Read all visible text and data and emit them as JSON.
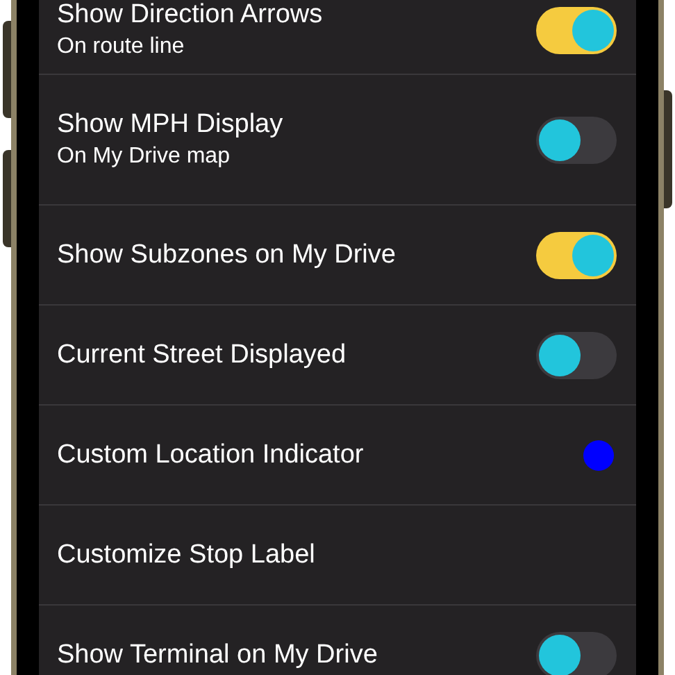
{
  "settings": [
    {
      "kind": "toggle",
      "title": "Show Direction Arrows",
      "subtitle": "On route line",
      "on": true
    },
    {
      "kind": "toggle",
      "title": "Show MPH Display",
      "subtitle": "On My Drive map",
      "on": false
    },
    {
      "kind": "toggle",
      "title": "Show Subzones on My Drive",
      "on": true
    },
    {
      "kind": "toggle",
      "title": "Current Street Displayed",
      "on": false
    },
    {
      "kind": "color",
      "title": "Custom Location Indicator",
      "color": "#0000ff"
    },
    {
      "kind": "link",
      "title": "Customize Stop Label"
    },
    {
      "kind": "toggle",
      "title": "Show Terminal on My Drive",
      "on": false
    }
  ]
}
